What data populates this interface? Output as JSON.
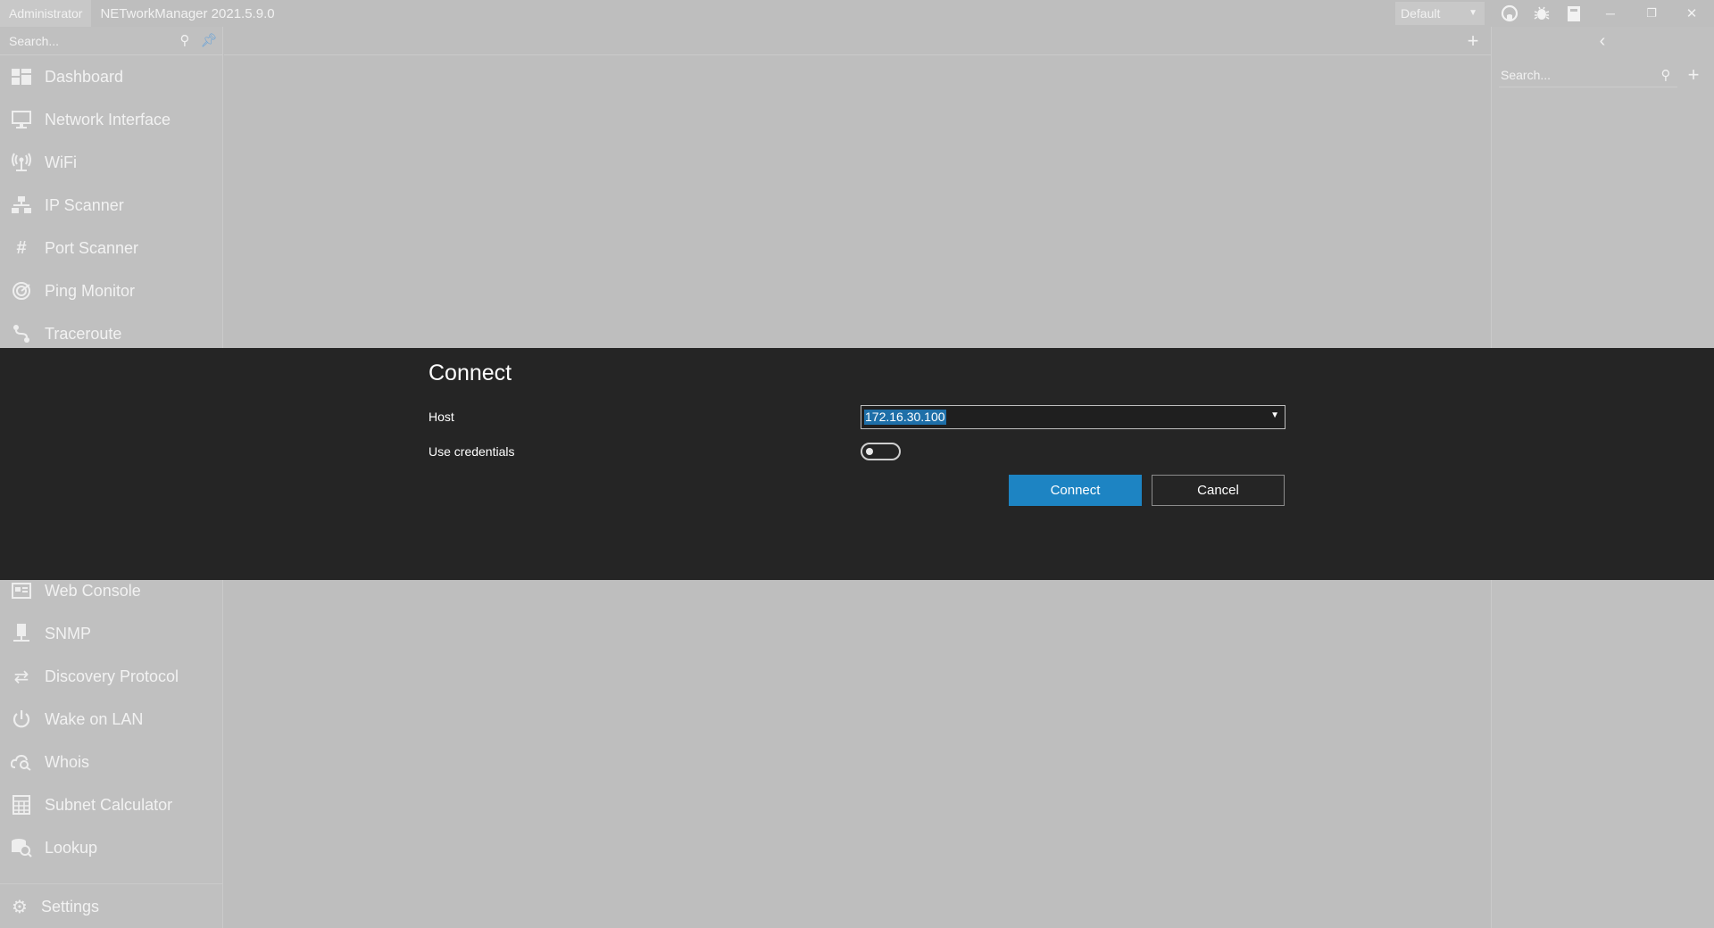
{
  "titlebar": {
    "admin_label": "Administrator",
    "app_title": "NETworkManager 2021.5.9.0",
    "profile_value": "Default",
    "icons": [
      "github-icon",
      "bug-icon",
      "clipboard-icon",
      "minimize-icon",
      "restore-icon",
      "close-icon"
    ]
  },
  "sidebar": {
    "search_placeholder": "Search...",
    "items_top": [
      {
        "label": "Dashboard",
        "icon": "dashboard-icon"
      },
      {
        "label": "Network Interface",
        "icon": "network-interface-icon"
      },
      {
        "label": "WiFi",
        "icon": "wifi-icon"
      },
      {
        "label": "IP Scanner",
        "icon": "ip-scanner-icon"
      },
      {
        "label": "Port Scanner",
        "icon": "port-scanner-icon"
      },
      {
        "label": "Ping Monitor",
        "icon": "ping-monitor-icon"
      },
      {
        "label": "Traceroute",
        "icon": "traceroute-icon"
      }
    ],
    "items_bottom": [
      {
        "label": "Web Console",
        "icon": "web-console-icon"
      },
      {
        "label": "SNMP",
        "icon": "snmp-icon"
      },
      {
        "label": "Discovery Protocol",
        "icon": "discovery-protocol-icon"
      },
      {
        "label": "Wake on LAN",
        "icon": "power-icon"
      },
      {
        "label": "Whois",
        "icon": "whois-icon"
      },
      {
        "label": "Subnet Calculator",
        "icon": "calculator-icon"
      },
      {
        "label": "Lookup",
        "icon": "lookup-icon"
      }
    ],
    "settings_label": "Settings"
  },
  "right_panel": {
    "search_placeholder": "Search..."
  },
  "dialog": {
    "title": "Connect",
    "host_label": "Host",
    "host_value": "172.16.30.100",
    "credentials_label": "Use credentials",
    "credentials_enabled": false,
    "connect_label": "Connect",
    "cancel_label": "Cancel",
    "accent_color": "#1d84c3"
  }
}
